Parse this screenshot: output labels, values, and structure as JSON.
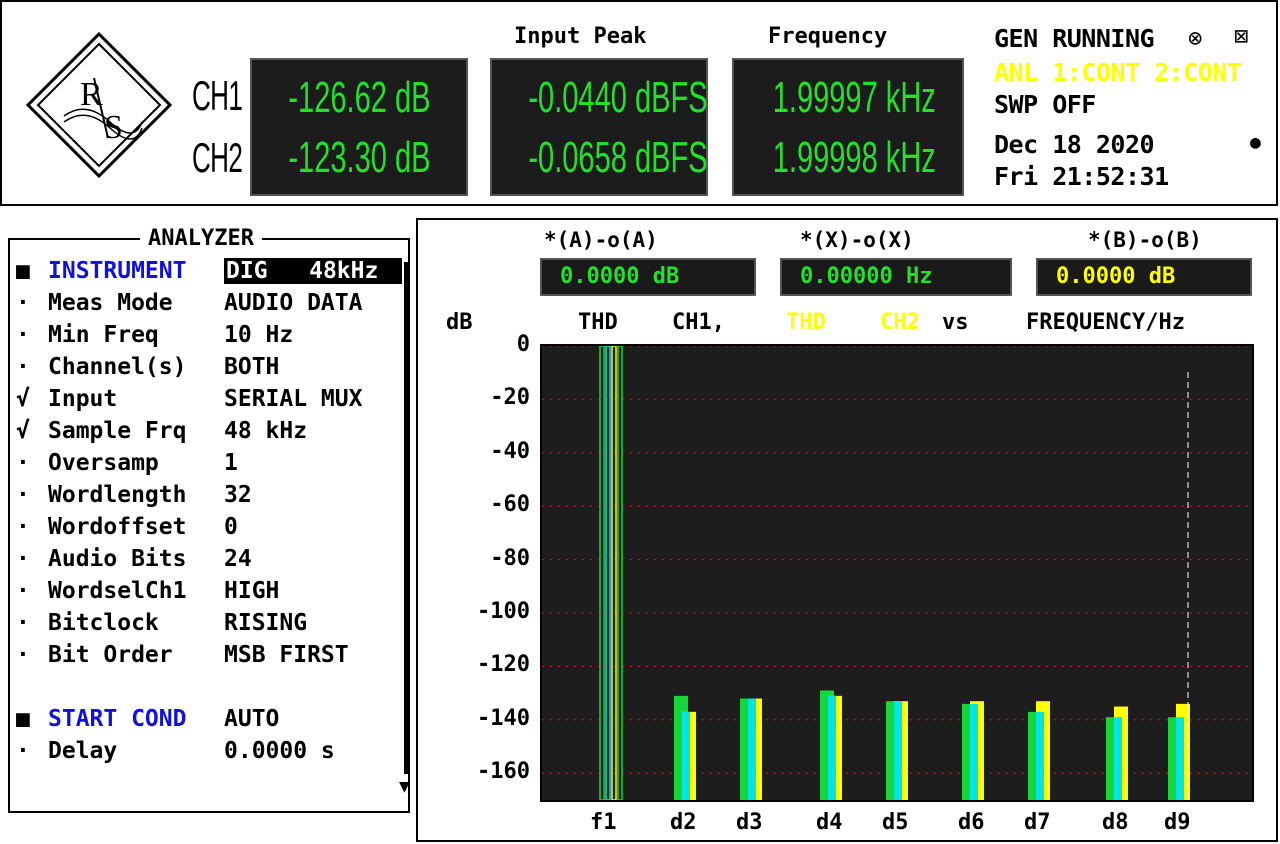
{
  "channels": {
    "ch1_label": "CH1",
    "ch2_label": "CH2",
    "ch1_level": "-126.62 dB",
    "ch2_level": "-123.30 dB"
  },
  "input_peak": {
    "title": "Input Peak",
    "ch1": "-0.0440 dBFS",
    "ch2": "-0.0658 dBFS"
  },
  "frequency": {
    "title": "Frequency",
    "ch1": "1.99997 kHz",
    "ch2": "1.99998 kHz"
  },
  "status": {
    "gen": "GEN RUNNING",
    "anl": "ANL 1:CONT 2:CONT",
    "swp": "SWP OFF",
    "date": "Dec 18 2020",
    "time": "Fri 21:52:31"
  },
  "colors": {
    "display_green": "#22e12a",
    "yellow": "#ffff00",
    "blue": "#1010e0",
    "cyan": "#00e5e5",
    "green": "#17d63a",
    "grid_red": "#d01818"
  },
  "menu": {
    "title": "ANALYZER",
    "rows": [
      {
        "mark": "■",
        "label": "INSTRUMENT",
        "value": "DIG",
        "value2": "48kHz"
      },
      {
        "mark": "·",
        "label": "Meas Mode",
        "value": "AUDIO DATA"
      },
      {
        "mark": "·",
        "label": "Min Freq",
        "value": "10 Hz"
      },
      {
        "mark": "·",
        "label": "Channel(s)",
        "value": "BOTH"
      },
      {
        "mark": "√",
        "label": "Input",
        "value": "SERIAL MUX"
      },
      {
        "mark": "√",
        "label": "Sample Frq",
        "value": "48 kHz"
      },
      {
        "mark": "·",
        "label": "Oversamp",
        "value": "1"
      },
      {
        "mark": "·",
        "label": "Wordlength",
        "value": "32"
      },
      {
        "mark": "·",
        "label": "Wordoffset",
        "value": "0"
      },
      {
        "mark": "·",
        "label": "Audio Bits",
        "value": "24"
      },
      {
        "mark": "·",
        "label": "WordselCh1",
        "value": "HIGH"
      },
      {
        "mark": "·",
        "label": "Bitclock",
        "value": "RISING"
      },
      {
        "mark": "·",
        "label": "Bit Order",
        "value": "MSB FIRST"
      },
      {
        "mark": "■",
        "label": "START COND",
        "value": "AUTO"
      },
      {
        "mark": "·",
        "label": "Delay",
        "value": "0.0000 s"
      }
    ]
  },
  "cursors": [
    {
      "title": "*(A)-o(A)",
      "value": "0.0000 dB"
    },
    {
      "title": "*(X)-o(X)",
      "value": "0.00000 Hz"
    },
    {
      "title": "*(B)-o(B)",
      "value": "0.0000 dB"
    }
  ],
  "legend": {
    "unit": "dB",
    "thd1": "THD",
    "ch1": "CH1,",
    "thd2": "THD",
    "ch2": "CH2",
    "vs": "vs",
    "xaxis": "FREQUENCY/Hz"
  },
  "chart_data": {
    "type": "bar",
    "ylabel": "dB",
    "ylim": [
      -170,
      0
    ],
    "yticks": [
      "0",
      "-20",
      "-40",
      "-60",
      "-80",
      "-100",
      "-120",
      "-140",
      "-160"
    ],
    "categories": [
      "f1",
      "d2",
      "d3",
      "d4",
      "d5",
      "d6",
      "d7",
      "d8",
      "d9"
    ],
    "series": [
      {
        "name": "CH1",
        "color": "#17d63a",
        "values": [
          0,
          -131,
          -132,
          -129,
          -133,
          -134,
          -137,
          -139,
          -139
        ]
      },
      {
        "name": "CH2",
        "color": "#ffff00",
        "values": [
          0,
          -137,
          -132,
          -131,
          -133,
          -133,
          -133,
          -135,
          -134
        ]
      }
    ],
    "grid": true
  }
}
